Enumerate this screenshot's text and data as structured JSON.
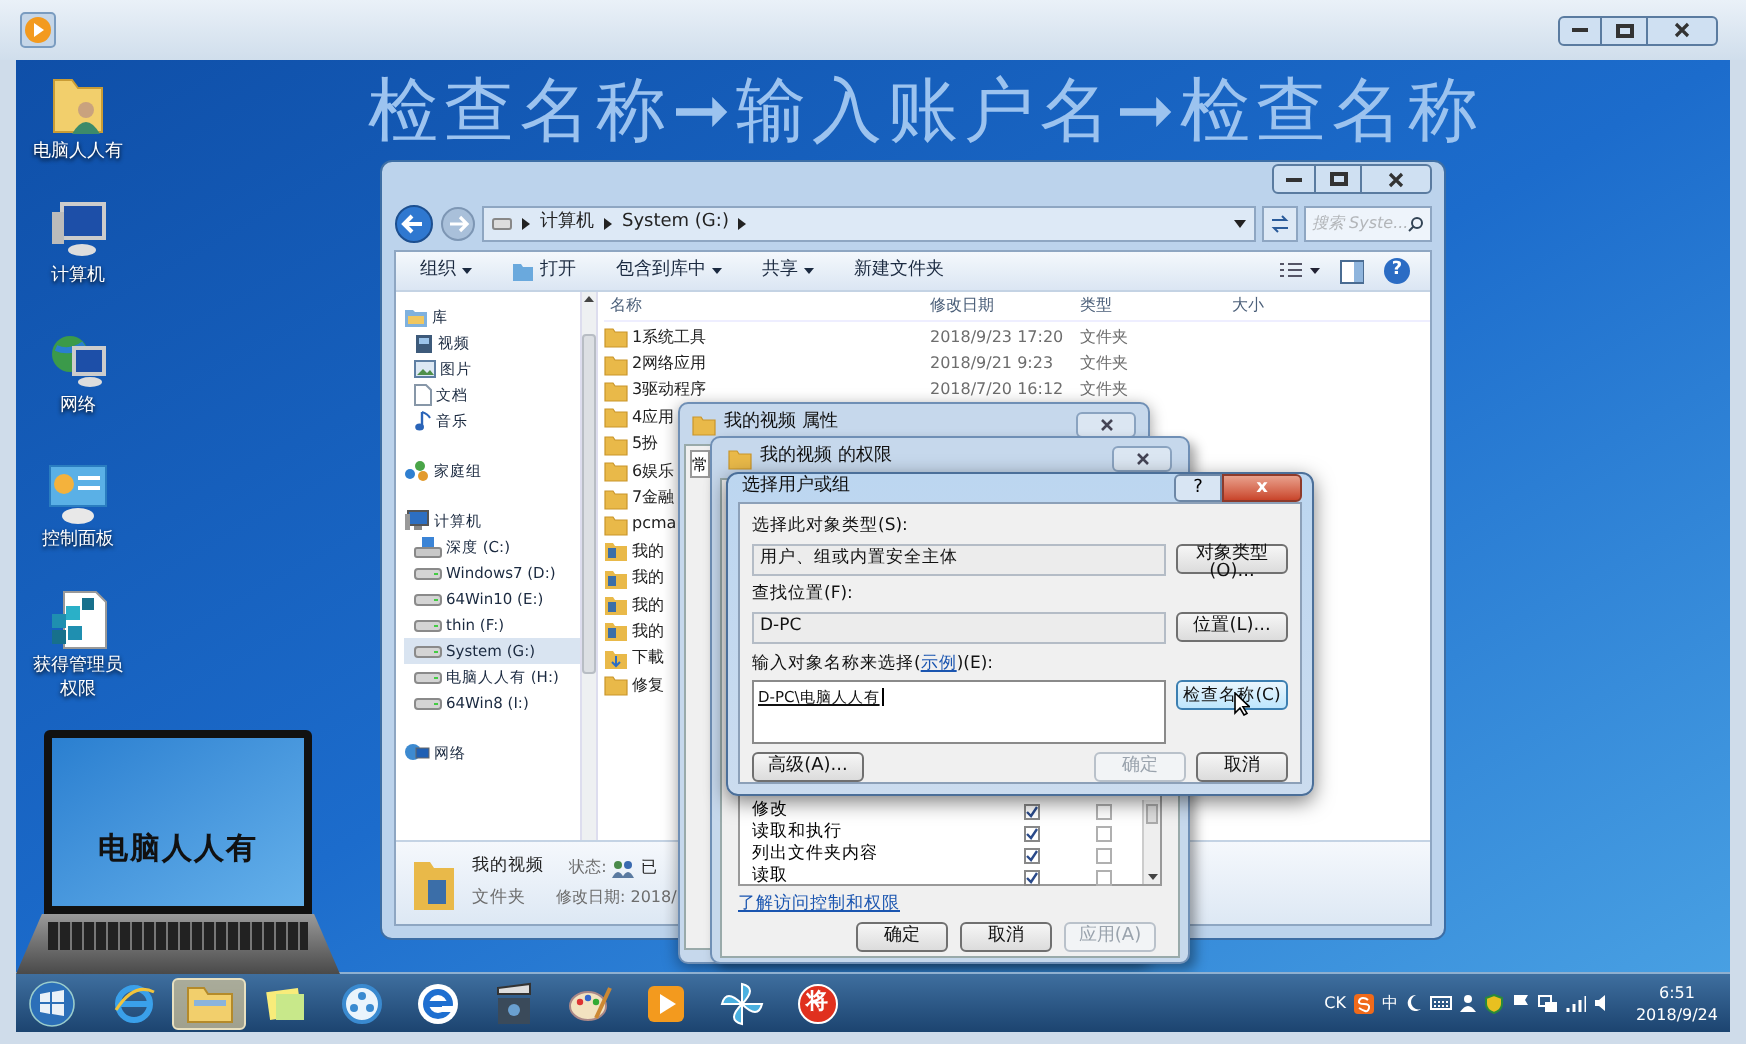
{
  "headline": "检查名称➞输入账户名➞检查名称",
  "desktop_icons": [
    {
      "kind": "user-folder",
      "label": "电脑人人有"
    },
    {
      "kind": "computer",
      "label": "计算机"
    },
    {
      "kind": "network",
      "label": "网络"
    },
    {
      "kind": "control-panel",
      "label": "控制面板"
    },
    {
      "kind": "registry",
      "label": "获得管理员权限"
    }
  ],
  "laptop_caption": "电脑人人有",
  "explorer": {
    "breadcrumb": [
      "计算机",
      "System (G:)"
    ],
    "search": {
      "placeholder": "搜索 Syste..."
    },
    "help": "?",
    "toolbar": [
      {
        "label": "组织",
        "dropdown": true,
        "kind": "menu"
      },
      {
        "label": "打开",
        "dropdown": false,
        "kind": "open"
      },
      {
        "label": "包含到库中",
        "dropdown": true,
        "kind": "menu"
      },
      {
        "label": "共享",
        "dropdown": true,
        "kind": "menu"
      },
      {
        "label": "新建文件夹",
        "dropdown": false,
        "kind": "menu"
      }
    ],
    "nav": [
      {
        "kind": "library",
        "label": "库",
        "selected": false,
        "children": [
          {
            "kind": "video",
            "label": "视频",
            "selected": false
          },
          {
            "kind": "picture",
            "label": "图片",
            "selected": false
          },
          {
            "kind": "document",
            "label": "文档",
            "selected": false
          },
          {
            "kind": "music",
            "label": "音乐",
            "selected": false
          }
        ]
      },
      {
        "kind": "homegroup",
        "label": "家庭组",
        "selected": false
      },
      {
        "kind": "computer",
        "label": "计算机",
        "selected": false,
        "children": [
          {
            "kind": "system-drive",
            "label": "深度 (C:)",
            "selected": false
          },
          {
            "kind": "drive",
            "label": "Windows7 (D:)",
            "selected": false
          },
          {
            "kind": "drive",
            "label": "64Win10 (E:)",
            "selected": false
          },
          {
            "kind": "drive",
            "label": "thin (F:)",
            "selected": false
          },
          {
            "kind": "drive",
            "label": "System (G:)",
            "selected": true
          },
          {
            "kind": "drive",
            "label": "电脑人人有 (H:)",
            "selected": false
          },
          {
            "kind": "drive",
            "label": "64Win8  (I:)",
            "selected": false
          }
        ]
      },
      {
        "kind": "network",
        "label": "网络",
        "selected": false
      }
    ],
    "columns": [
      "名称",
      "修改日期",
      "类型",
      "大小"
    ],
    "files": [
      {
        "kind": "folder",
        "name": "1系统工具",
        "modified": "2018/9/23 17:20",
        "type": "文件夹"
      },
      {
        "kind": "folder",
        "name": "2网络应用",
        "modified": "2018/9/21 9:23",
        "type": "文件夹"
      },
      {
        "kind": "folder",
        "name": "3驱动程序",
        "modified": "2018/7/20 16:12",
        "type": "文件夹"
      },
      {
        "kind": "folder",
        "name": "4应用"
      },
      {
        "kind": "folder",
        "name": "5扮"
      },
      {
        "kind": "folder",
        "name": "6娱乐"
      },
      {
        "kind": "folder",
        "name": "7金融"
      },
      {
        "kind": "folder",
        "name": "pcma"
      },
      {
        "kind": "library",
        "name": "我的"
      },
      {
        "kind": "library",
        "name": "我的"
      },
      {
        "kind": "library",
        "name": "我的"
      },
      {
        "kind": "library",
        "name": "我的"
      },
      {
        "kind": "download",
        "name": "下載"
      },
      {
        "kind": "folder",
        "name": "修复"
      }
    ],
    "details": {
      "name": "我的视频",
      "type": "文件夹",
      "status_label": "状态:",
      "status": "已",
      "modified": "修改日期: 2018/"
    }
  },
  "properties_dialog": {
    "title": "我的视频 属性",
    "tab": "常"
  },
  "permissions_dialog": {
    "title": "我的视频 的权限",
    "permissions": [
      {
        "name": "修改",
        "allow": true,
        "deny": false
      },
      {
        "name": "读取和执行",
        "allow": true,
        "deny": false
      },
      {
        "name": "列出文件夹内容",
        "allow": true,
        "deny": false
      },
      {
        "name": "读取",
        "allow": true,
        "deny": false
      }
    ],
    "link": "了解访问控制和权限",
    "buttons": [
      {
        "label": "确定",
        "disabled": false
      },
      {
        "label": "取消",
        "disabled": false
      },
      {
        "label": "应用(A)",
        "disabled": true
      }
    ]
  },
  "select_dialog": {
    "title": "选择用户或组",
    "help": "?",
    "close": "x",
    "object_type_label": "选择此对象类型(S):",
    "object_type": "用户、组或内置安全主体",
    "object_type_button": "对象类型(O)...",
    "location_label": "查找位置(F):",
    "location": "D-PC",
    "location_button": "位置(L)...",
    "names_label_before": "输入对象名称来选择(",
    "names_link": "示例",
    "names_label_after": ")(E):",
    "names_value": "D-PC\\电脑人人有",
    "check_button": {
      "label": "检查名称(C)",
      "hovered": true
    },
    "advanced_button": "高级(A)...",
    "buttons": [
      {
        "label": "确定",
        "disabled": true
      },
      {
        "label": "取消",
        "disabled": false
      }
    ]
  },
  "taskbar": {
    "apps": [
      {
        "kind": "ie"
      },
      {
        "kind": "explorer",
        "selected": true
      },
      {
        "kind": "notes"
      },
      {
        "kind": "media-center"
      },
      {
        "kind": "ie-blue"
      },
      {
        "kind": "movie"
      },
      {
        "kind": "paint"
      },
      {
        "kind": "player"
      },
      {
        "kind": "pinwheel"
      },
      {
        "kind": "badge",
        "label": "将"
      }
    ],
    "tray_texts": [
      "CK",
      "中"
    ],
    "time": "6:51",
    "date": "2018/9/24"
  }
}
